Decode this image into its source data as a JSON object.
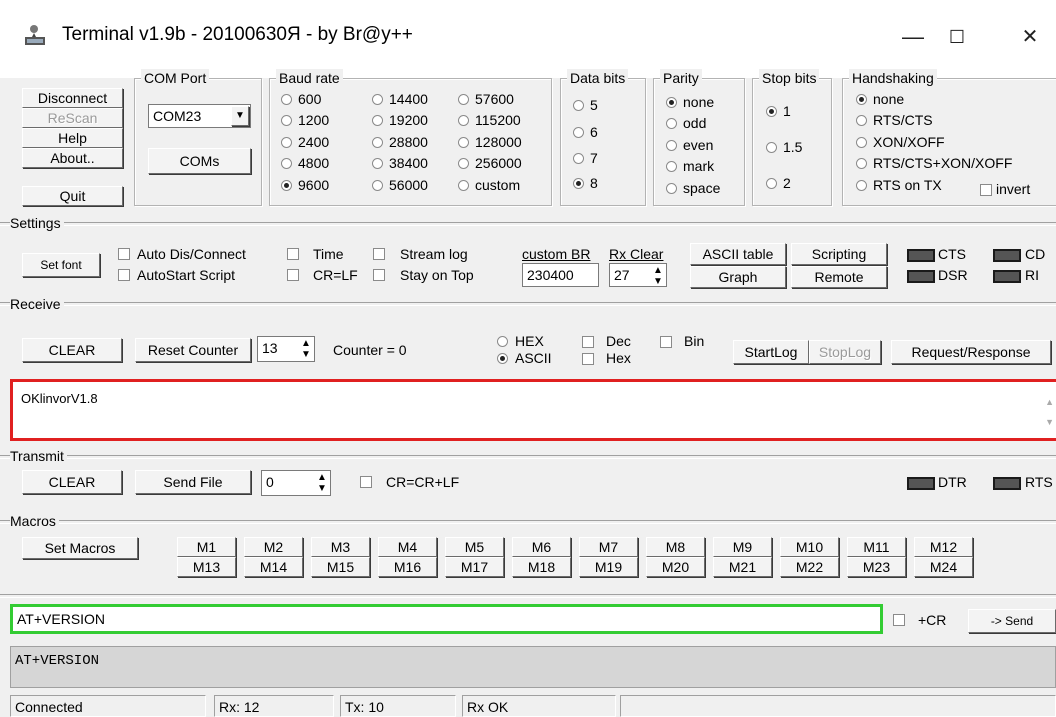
{
  "window": {
    "title": "Terminal v1.9b - 20100630Я - by Br@y++",
    "min": "—",
    "max": "☐",
    "close": "✕"
  },
  "left_buttons": {
    "disconnect": "Disconnect",
    "rescan": "ReScan",
    "help": "Help",
    "about": "About..",
    "quit": "Quit"
  },
  "com_port": {
    "title": "COM Port",
    "value": "COM23",
    "coms_button": "COMs"
  },
  "baud": {
    "title": "Baud rate",
    "rates": [
      "600",
      "14400",
      "57600",
      "1200",
      "19200",
      "115200",
      "2400",
      "28800",
      "128000",
      "4800",
      "38400",
      "256000",
      "9600",
      "56000",
      "custom"
    ],
    "selected": "9600"
  },
  "data_bits": {
    "title": "Data bits",
    "options": [
      "5",
      "6",
      "7",
      "8"
    ],
    "selected": "8"
  },
  "parity": {
    "title": "Parity",
    "options": [
      "none",
      "odd",
      "even",
      "mark",
      "space"
    ],
    "selected": "none"
  },
  "stop_bits": {
    "title": "Stop bits",
    "options": [
      "1",
      "1.5",
      "2"
    ],
    "selected": "1"
  },
  "handshaking": {
    "title": "Handshaking",
    "options": [
      "none",
      "RTS/CTS",
      "XON/XOFF",
      "RTS/CTS+XON/XOFF",
      "RTS on TX"
    ],
    "selected": "none",
    "invert": "invert"
  },
  "settings": {
    "title": "Settings",
    "set_font": "Set font",
    "auto_dis": "Auto Dis/Connect",
    "autostart": "AutoStart Script",
    "time": "Time",
    "crlf": "CR=LF",
    "stream_log": "Stream log",
    "stay_on_top": "Stay on Top",
    "custom_br_label": "custom BR",
    "custom_br_value": "230400",
    "rx_clear_label": "Rx Clear",
    "rx_clear_value": "27",
    "ascii_table": "ASCII table",
    "graph": "Graph",
    "scripting": "Scripting",
    "remote": "Remote",
    "cts": "CTS",
    "cd": "CD",
    "dsr": "DSR",
    "ri": "RI"
  },
  "receive": {
    "title": "Receive",
    "clear": "CLEAR",
    "reset_counter": "Reset Counter",
    "counter_spin": "13",
    "counter_text": "Counter = 0",
    "hex": "HEX",
    "ascii": "ASCII",
    "dec": "Dec",
    "bin": "Bin",
    "hex2": "Hex",
    "startlog": "StartLog",
    "stoplog": "StopLog",
    "request_response": "Request/Response",
    "output": "OKlinvorV1.8"
  },
  "transmit": {
    "title": "Transmit",
    "clear": "CLEAR",
    "send_file": "Send File",
    "spin_value": "0",
    "crcrlf": "CR=CR+LF",
    "dtr": "DTR",
    "rts": "RTS"
  },
  "macros": {
    "title": "Macros",
    "set_macros": "Set Macros",
    "row1": [
      "M1",
      "M2",
      "M3",
      "M4",
      "M5",
      "M6",
      "M7",
      "M8",
      "M9",
      "M10",
      "M11",
      "M12"
    ],
    "row2": [
      "M13",
      "M14",
      "M15",
      "M16",
      "M17",
      "M18",
      "M19",
      "M20",
      "M21",
      "M22",
      "M23",
      "M24"
    ]
  },
  "input": {
    "command": "AT+VERSION",
    "cr_label": "+CR",
    "send": "-> Send"
  },
  "history": {
    "line": "AT+VERSION"
  },
  "status": {
    "connected": "Connected",
    "rx": "Rx: 12",
    "tx": "Tx: 10",
    "rx_ok": "Rx OK"
  },
  "colors": {
    "receive_highlight": "#e02020",
    "input_highlight": "#33cc33"
  }
}
